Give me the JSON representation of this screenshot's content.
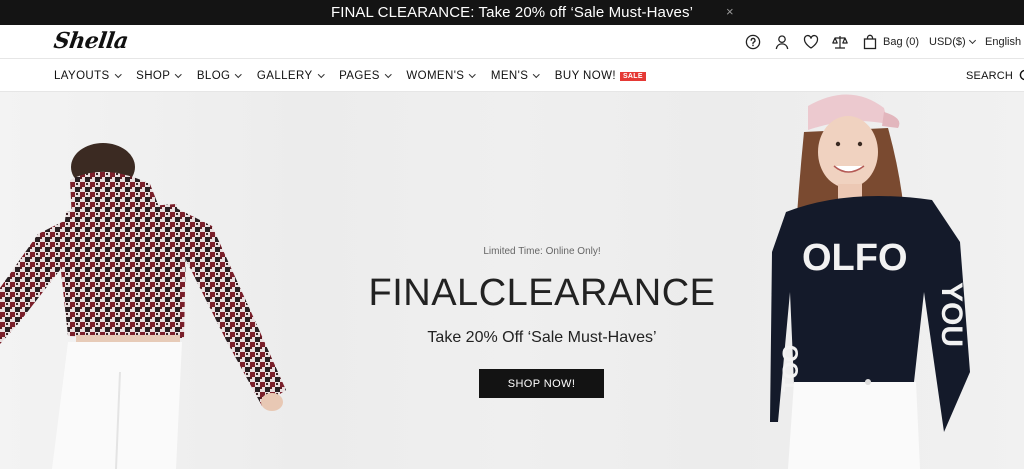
{
  "announcement": {
    "text": "FINAL CLEARANCE: Take 20% off ‘Sale Must-Haves’",
    "close": "×"
  },
  "header": {
    "logo": "Shella",
    "icons": [
      "help-icon",
      "user-icon",
      "heart-icon",
      "compare-icon",
      "bag-icon"
    ],
    "bag_label": "Bag (0)",
    "currency": "USD($)",
    "language": "English"
  },
  "nav": {
    "items": [
      {
        "label": "LAYOUTS"
      },
      {
        "label": "SHOP"
      },
      {
        "label": "BLOG"
      },
      {
        "label": "GALLERY"
      },
      {
        "label": "PAGES"
      },
      {
        "label": "WOMEN'S"
      },
      {
        "label": "MEN'S"
      },
      {
        "label": "BUY NOW!"
      }
    ],
    "sale_badge": "SALE",
    "search_label": "SEARCH"
  },
  "hero": {
    "kicker": "Limited Time: Online Only!",
    "title": "FINALCLEARANCE",
    "subtitle": "Take 20% Off ‘Sale Must-Haves’",
    "button": "SHOP NOW!"
  },
  "colors": {
    "announcement_bg": "#141414",
    "button_bg": "#131313",
    "sale_badge": "#e53935"
  }
}
